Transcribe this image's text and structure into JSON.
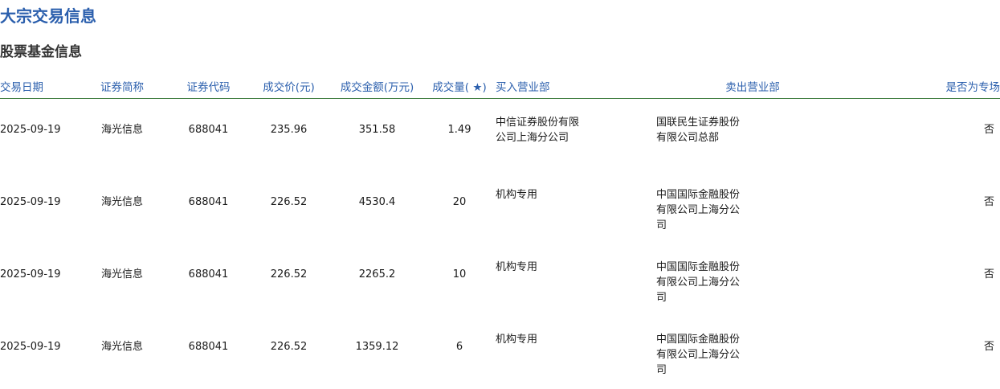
{
  "page": {
    "title": "大宗交易信息",
    "section_title": "股票基金信息"
  },
  "table": {
    "headers": {
      "date": "交易日期",
      "name": "证券简称",
      "code": "证券代码",
      "price": "成交价(元)",
      "amount": "成交金额(万元)",
      "volume": "成交量( ★)",
      "buyer": "买入营业部",
      "seller": "卖出营业部",
      "special": "是否为专场"
    },
    "rows": [
      {
        "date": "2025-09-19",
        "name": "海光信息",
        "code": "688041",
        "price": "235.96",
        "amount": "351.58",
        "volume": "1.49",
        "buyer": "中信证券股份有限公司上海分公司",
        "seller": "国联民生证券股份有限公司总部",
        "special": "否"
      },
      {
        "date": "2025-09-19",
        "name": "海光信息",
        "code": "688041",
        "price": "226.52",
        "amount": "4530.4",
        "volume": "20",
        "buyer": "机构专用",
        "seller": "中国国际金融股份有限公司上海分公司",
        "special": "否"
      },
      {
        "date": "2025-09-19",
        "name": "海光信息",
        "code": "688041",
        "price": "226.52",
        "amount": "2265.2",
        "volume": "10",
        "buyer": "机构专用",
        "seller": "中国国际金融股份有限公司上海分公司",
        "special": "否"
      },
      {
        "date": "2025-09-19",
        "name": "海光信息",
        "code": "688041",
        "price": "226.52",
        "amount": "1359.12",
        "volume": "6",
        "buyer": "机构专用",
        "seller": "中国国际金融股份有限公司上海分公司",
        "special": "否"
      }
    ]
  }
}
